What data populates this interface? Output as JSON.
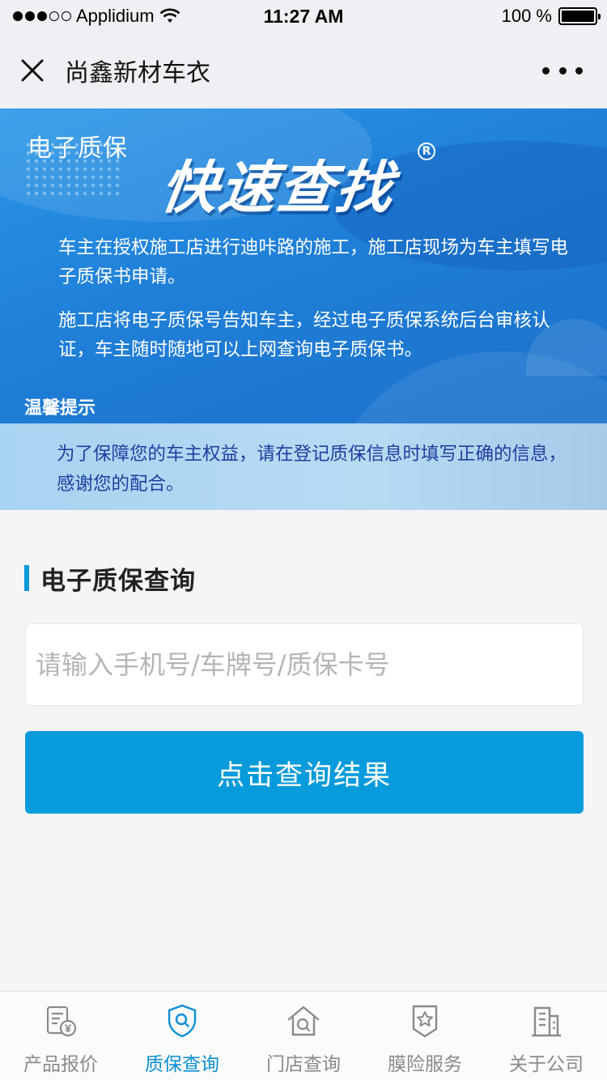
{
  "status_bar": {
    "carrier": "Applidium",
    "time": "11:27 AM",
    "battery": "100 %",
    "signal_bars_on": 3,
    "signal_bars_total": 5
  },
  "nav": {
    "title": "尚鑫新材车衣"
  },
  "banner": {
    "tag": "电子质保",
    "headline": "快速查找",
    "registered_mark": "R",
    "paragraph_1": "车主在授权施工店进行迪咔路的施工，施工店现场为车主填写电子质保书申请。",
    "paragraph_2": "施工店将电子质保号告知车主，经过电子质保系统后台审核认证，车主随时随地可以上网查询电子质保书。",
    "tip_title": "温馨提示",
    "tip_text": "为了保障您的车主权益，请在登记质保信息时填写正确的信息，感谢您的配合。"
  },
  "query": {
    "section_title": "电子质保查询",
    "input_value": "",
    "input_placeholder": "请输入手机号/车牌号/质保卡号",
    "button_label": "点击查询结果"
  },
  "tabs": [
    {
      "label": "产品报价",
      "icon": "price-doc-icon",
      "active": false
    },
    {
      "label": "质保查询",
      "icon": "shield-search-icon",
      "active": true
    },
    {
      "label": "门店查询",
      "icon": "store-search-icon",
      "active": false
    },
    {
      "label": "膜险服务",
      "icon": "star-badge-icon",
      "active": false
    },
    {
      "label": "关于公司",
      "icon": "building-icon",
      "active": false
    }
  ],
  "colors": {
    "accent": "#079bdc",
    "tab_active": "#0a8fd6",
    "tab_inactive": "#8a8a8a",
    "tip_text": "#1f3e9f"
  }
}
